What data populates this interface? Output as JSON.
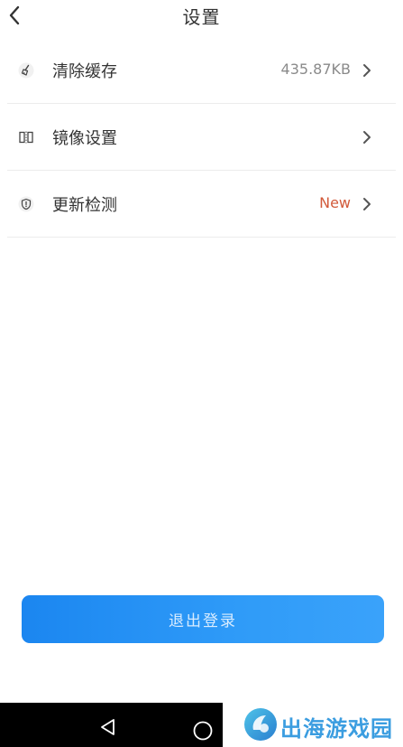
{
  "header": {
    "title": "设置"
  },
  "settings": {
    "items": [
      {
        "label": "清除缓存",
        "value": "435.87KB"
      },
      {
        "label": "镜像设置",
        "value": ""
      },
      {
        "label": "更新检测",
        "value": "New"
      }
    ]
  },
  "logout": {
    "label": "退出登录"
  },
  "watermark": {
    "text": "出海游戏园"
  },
  "colors": {
    "accent": "#1b86f0",
    "new_badge": "#d25a3a",
    "watermark": "#3b9de0"
  }
}
